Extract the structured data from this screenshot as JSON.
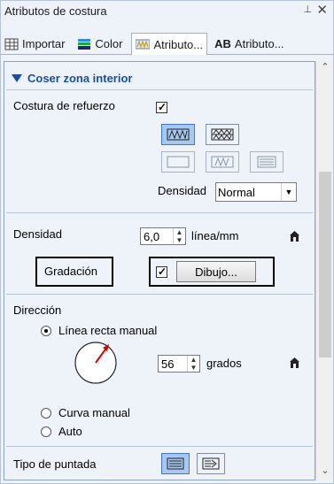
{
  "window": {
    "title": "Atributos de costura",
    "pin": "⊥",
    "close": "✕"
  },
  "tabs": [
    {
      "label": "Importar",
      "icon": "import-icon"
    },
    {
      "label": "Color",
      "icon": "color-icon"
    },
    {
      "label": "Atributo...",
      "icon": "stitch-attribute-icon"
    },
    {
      "label": "Atributo...",
      "icon": "text-attribute-icon",
      "prefix": "AB"
    }
  ],
  "section": {
    "title": "Coser zona interior"
  },
  "refuerzo": {
    "label": "Costura de refuerzo",
    "checked": true
  },
  "densidad_combo": {
    "label": "Densidad",
    "value": "Normal"
  },
  "densidad": {
    "label": "Densidad",
    "value": "6,0",
    "unit": "línea/mm"
  },
  "gradacion": {
    "label": "Gradación",
    "checked": true,
    "button": "Dibujo..."
  },
  "direccion": {
    "label": "Dirección",
    "options": [
      "Línea recta manual",
      "Curva manual",
      "Auto"
    ],
    "selected": 0,
    "angle": "56",
    "angle_unit": "grados"
  },
  "tipo_puntada": {
    "label": "Tipo de puntada"
  },
  "colors": {
    "accent": "#1a4fa0",
    "selected_button": "#a8c8f0"
  }
}
